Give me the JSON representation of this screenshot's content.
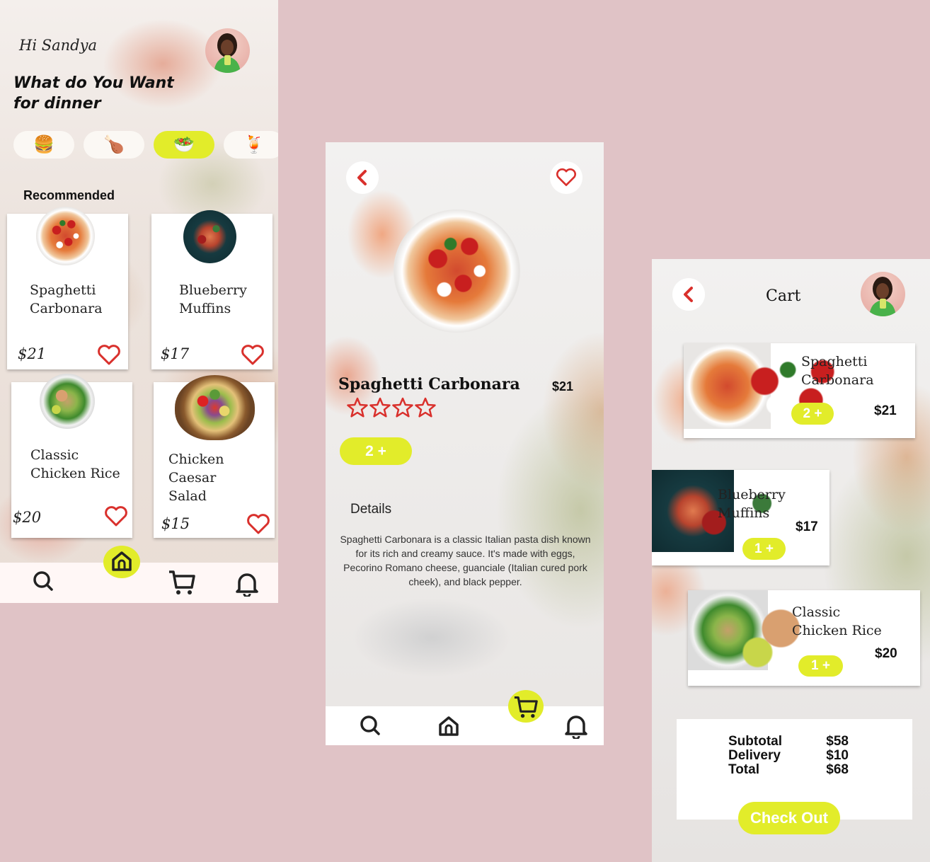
{
  "home": {
    "greeting": "Hi Sandya",
    "headline_line1": "What do You Want",
    "headline_line2": "for dinner",
    "categories": [
      {
        "icon": "burger-icon",
        "glyph": "🍔",
        "active": false
      },
      {
        "icon": "roast-chicken-icon",
        "glyph": "🍗",
        "active": false
      },
      {
        "icon": "bowl-icon",
        "glyph": "🥗",
        "active": true
      },
      {
        "icon": "drink-icon",
        "glyph": "🍹",
        "active": false
      }
    ],
    "recommended_title": "Recommended",
    "items": [
      {
        "name_line1": "Spaghetti",
        "name_line2": "Carbonara",
        "price": "$21"
      },
      {
        "name_line1": "Blueberry",
        "name_line2": "Muffins",
        "price": "$17"
      },
      {
        "name_line1": "Classic",
        "name_line2": "Chicken Rice",
        "price": "$20"
      },
      {
        "name_line1": "Chicken Caesar",
        "name_line2": "Salad",
        "price": "$15"
      }
    ]
  },
  "detail": {
    "title": "Spaghetti Carbonara",
    "price": "$21",
    "rating_stars": 4,
    "quantity_label": "2 +",
    "details_heading": "Details",
    "description": "Spaghetti Carbonara is a classic Italian pasta dish known for its rich and creamy sauce. It's made with eggs, Pecorino Romano cheese, guanciale (Italian cured pork cheek), and black pepper."
  },
  "cart": {
    "title": "Cart",
    "items": [
      {
        "name_line1": "Spaghetti",
        "name_line2": "Carbonara",
        "price": "$21",
        "quantity": "2 +"
      },
      {
        "name_line1": "Blueberry",
        "name_line2": "Muffins",
        "price": "$17",
        "quantity": "1 +"
      },
      {
        "name_line1": "Classic",
        "name_line2": "Chicken Rice",
        "price": "$20",
        "quantity": "1 +"
      }
    ],
    "subtotal_label": "Subtotal",
    "subtotal_value": "$58",
    "delivery_label": "Delivery",
    "delivery_value": "$10",
    "total_label": "Total",
    "total_value": "$68",
    "checkout_label": "Check Out"
  },
  "colors": {
    "accent": "#e2ec2a",
    "heart": "#d9302c",
    "background": "#e0c3c6"
  }
}
